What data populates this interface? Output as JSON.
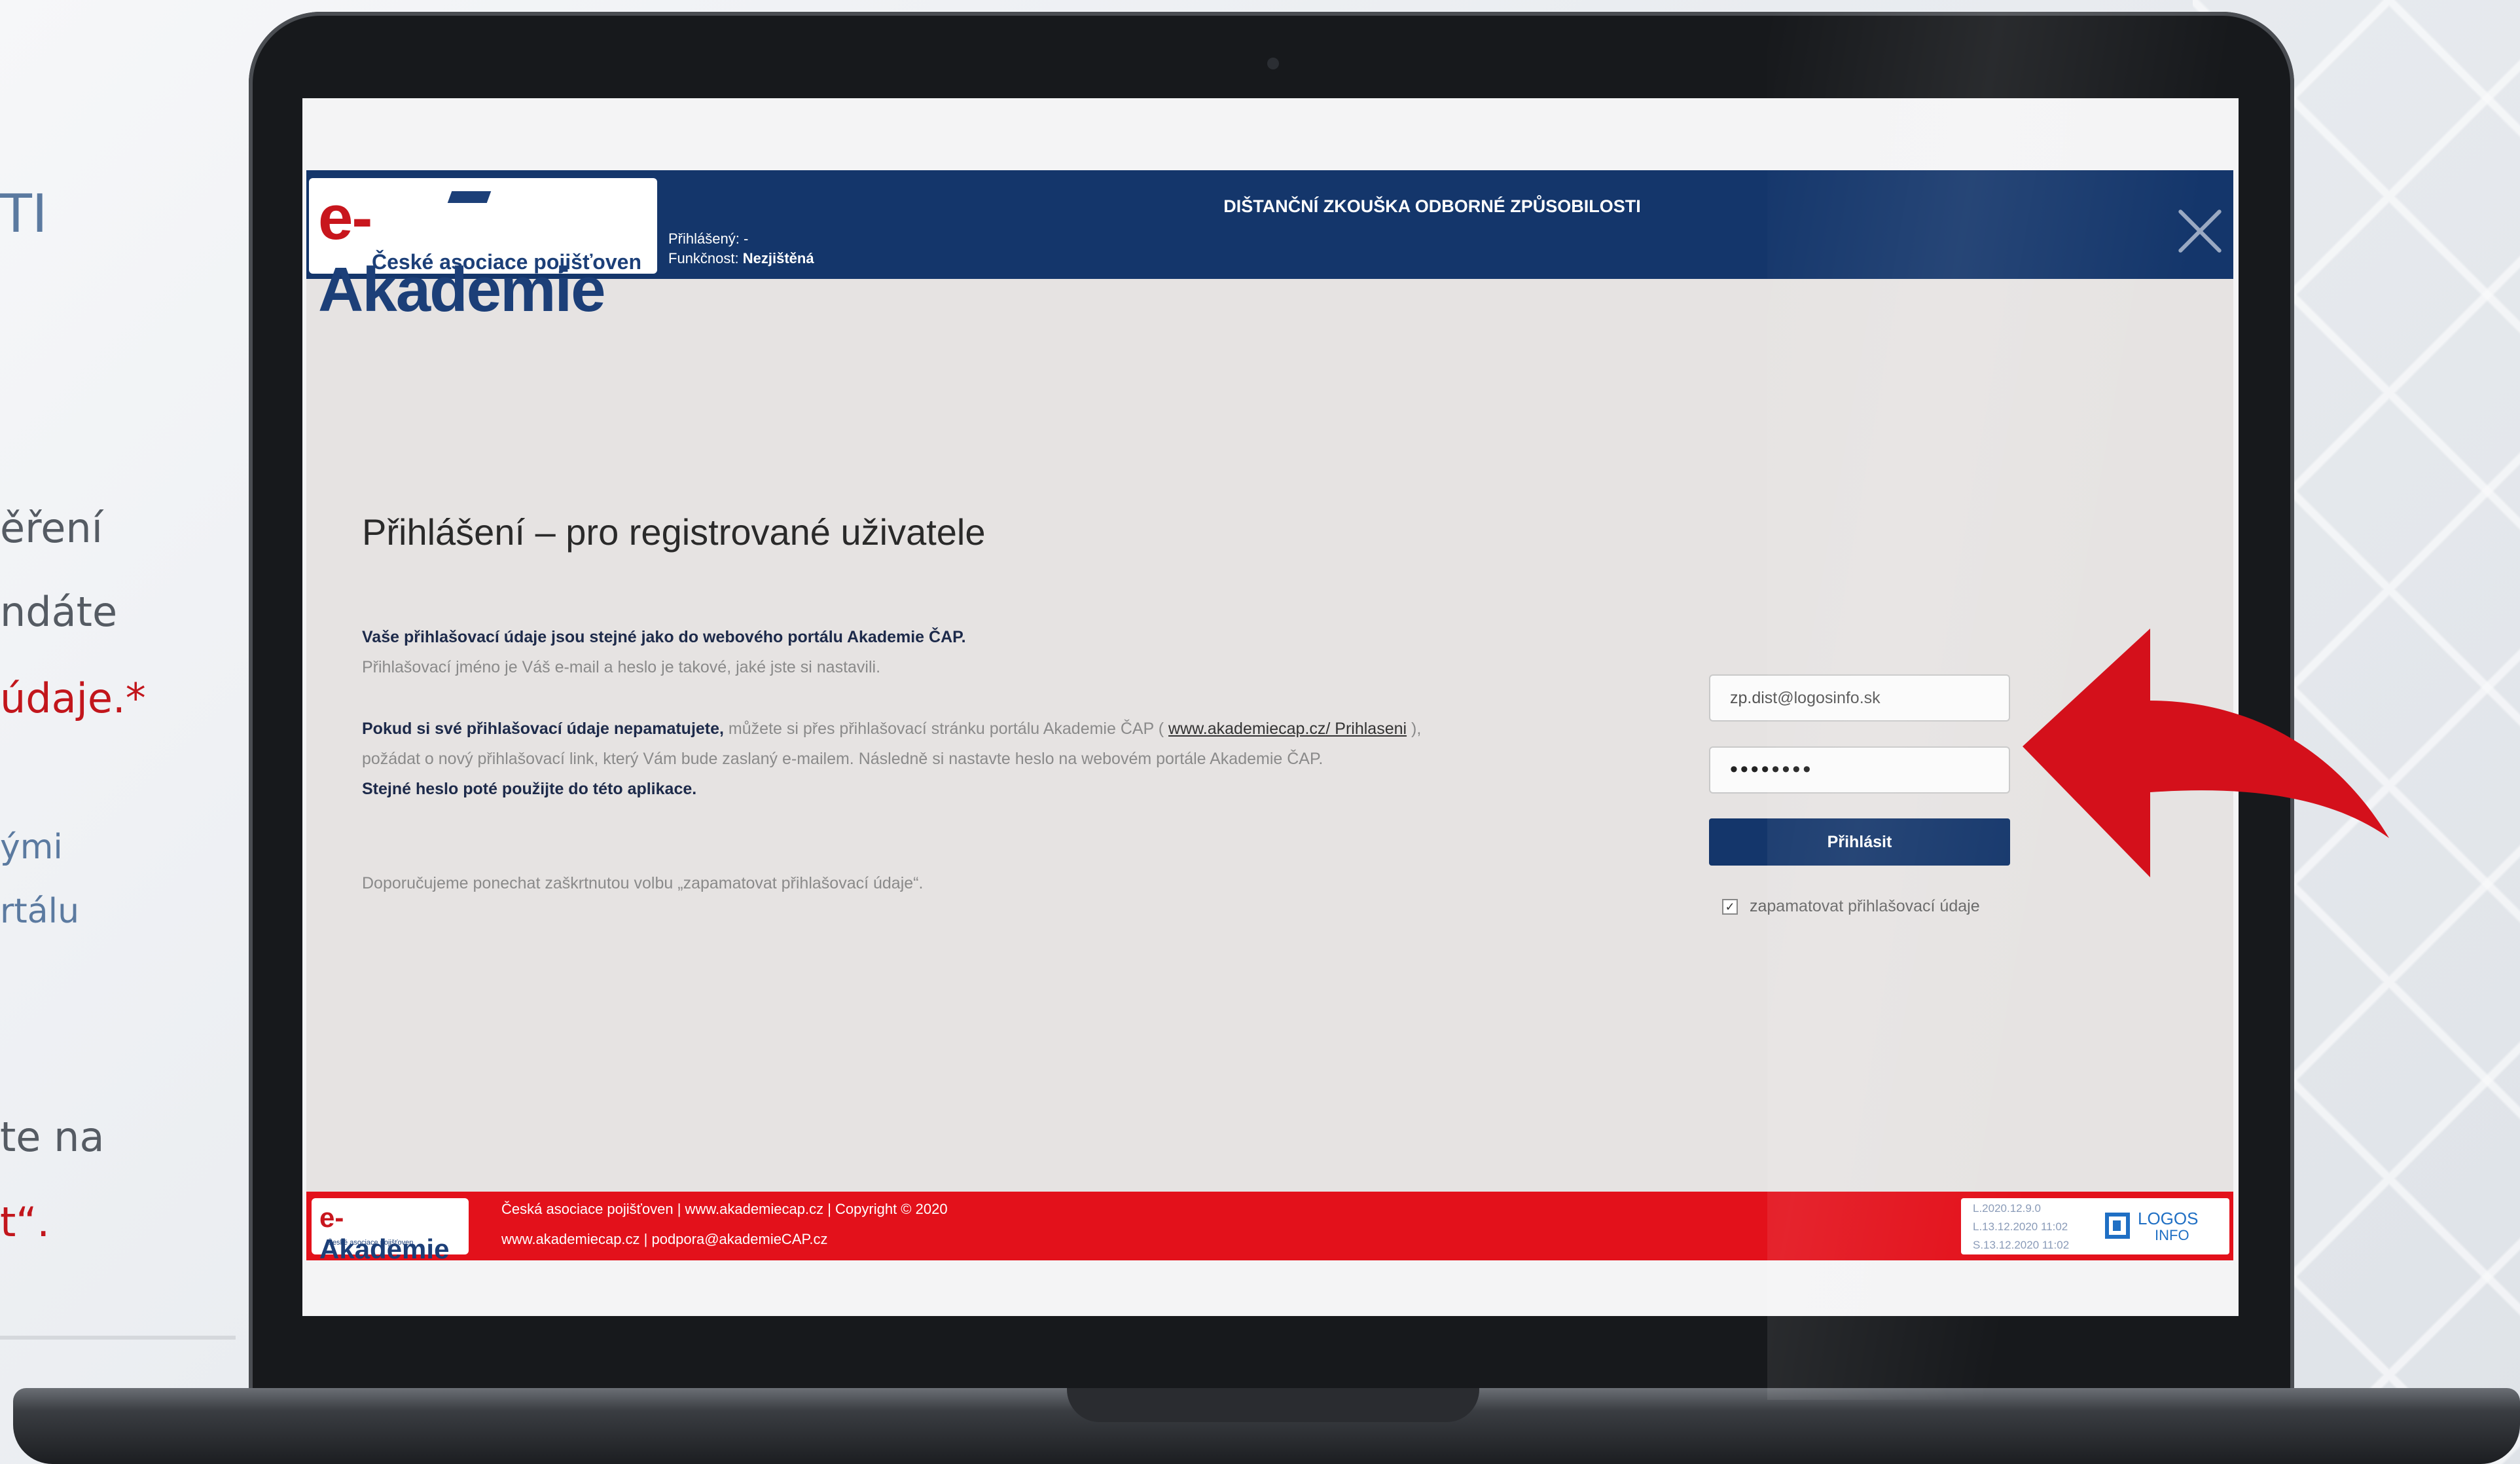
{
  "slide": {
    "heading_fragment": "TI",
    "line1": "ěření",
    "line2": "ndáte",
    "line3": "údaje.*",
    "line4": "ými",
    "line5": "rtálu",
    "line6": "te na",
    "line7": "t“."
  },
  "header": {
    "logo_text": "Akademie",
    "logo_prefix": "e-",
    "logo_subtitle": "České asociace pojišťoven",
    "logged_in_label": "Přihlášený:",
    "logged_in_value": "-",
    "role_label": "Funkčnost:",
    "role_value": "Nezjištěná",
    "title": "DIŠTANČNÍ ZKOUŠKA ODBORNÉ ZPŮSOBILOSTI"
  },
  "content": {
    "title": "Přihlášení – pro registrované uživatele",
    "p1_bold": "Vaše přihlašovací údaje jsou stejné jako do webového portálu Akademie ČAP.",
    "p1_text": "Přihlašovací jméno je Váš e-mail a heslo je takové, jaké jste si nastavili.",
    "p2_bold": "Pokud si své přihlašovací údaje nepamatujete,",
    "p2_text": " můžete si přes přihlašovací stránku portálu Akademie ČAP ( ",
    "p2_link": "www.akademiecap.cz/ Prihlaseni",
    "p2_text2": " ),",
    "p2_line3": "požádat o nový přihlašovací link, který Vám bude zaslaný e-mailem. Následně si nastavte heslo na webovém portále Akademie ČAP.",
    "p2_bold2": "Stejné heslo poté použijte do této aplikace.",
    "p3": "Doporučujeme ponechat zaškrtnutou volbu „zapamatovat přihlašovací údaje“."
  },
  "form": {
    "email_value": "zp.dist@logosinfo.sk",
    "password_value": "••••••••",
    "login_button": "Přihlásit",
    "remember_label": "zapamatovat přihlašovací údaje",
    "remember_checked": true
  },
  "footer": {
    "logo_prefix": "e-",
    "logo_text": "Akademie",
    "logo_sub": "České asociace pojišťoven",
    "line1": "Česká asociace pojišťoven | www.akademiecap.cz | Copyright © 2020",
    "line2": "www.akademiecap.cz | podpora@akademieCAP.cz",
    "version1": "L.2020.12.9.0",
    "version2": "L.13.12.2020 11:02",
    "version3": "S.13.12.2020 11:02",
    "brand1": "LOGOS",
    "brand2": "INFO"
  },
  "colors": {
    "header_blue": "#14366b",
    "footer_red": "#e3111b",
    "arrow_red": "#d4101b"
  }
}
